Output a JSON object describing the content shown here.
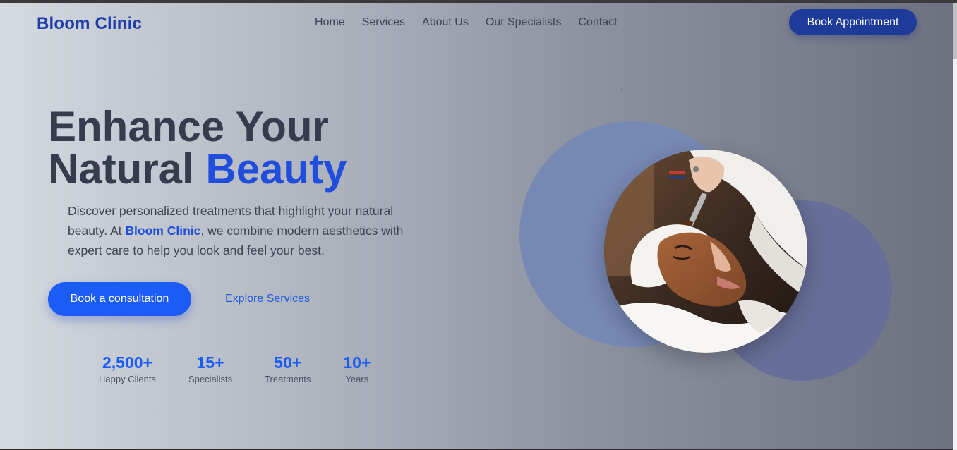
{
  "header": {
    "logo": "Bloom Clinic",
    "nav": [
      "Home",
      "Services",
      "About Us",
      "Our Specialists",
      "Contact"
    ],
    "cta": "Book Appointment"
  },
  "hero": {
    "title_line1": "Enhance Your",
    "title_line2_plain": "Natural ",
    "title_line2_accent": "Beauty",
    "desc_part1": "Discover personalized treatments that highlight your natural beauty. At ",
    "desc_brand": "Bloom Clinic",
    "desc_part2": ", we combine modern aesthetics with expert care to help you look and feel your best.",
    "primary_cta": "Book a consultation",
    "secondary_cta": "Explore Services"
  },
  "stats": [
    {
      "value": "2,500+",
      "label": "Happy Clients"
    },
    {
      "value": "15+",
      "label": "Specialists"
    },
    {
      "value": "50+",
      "label": "Treatments"
    },
    {
      "value": "10+",
      "label": "Years"
    }
  ],
  "colors": {
    "brand": "#1e3fa8",
    "accent": "#1f4ddc",
    "button": "#1a5cf5",
    "header_button": "#1e3b9a"
  },
  "icons": {
    "hero_image": "facial-treatment-photo"
  }
}
